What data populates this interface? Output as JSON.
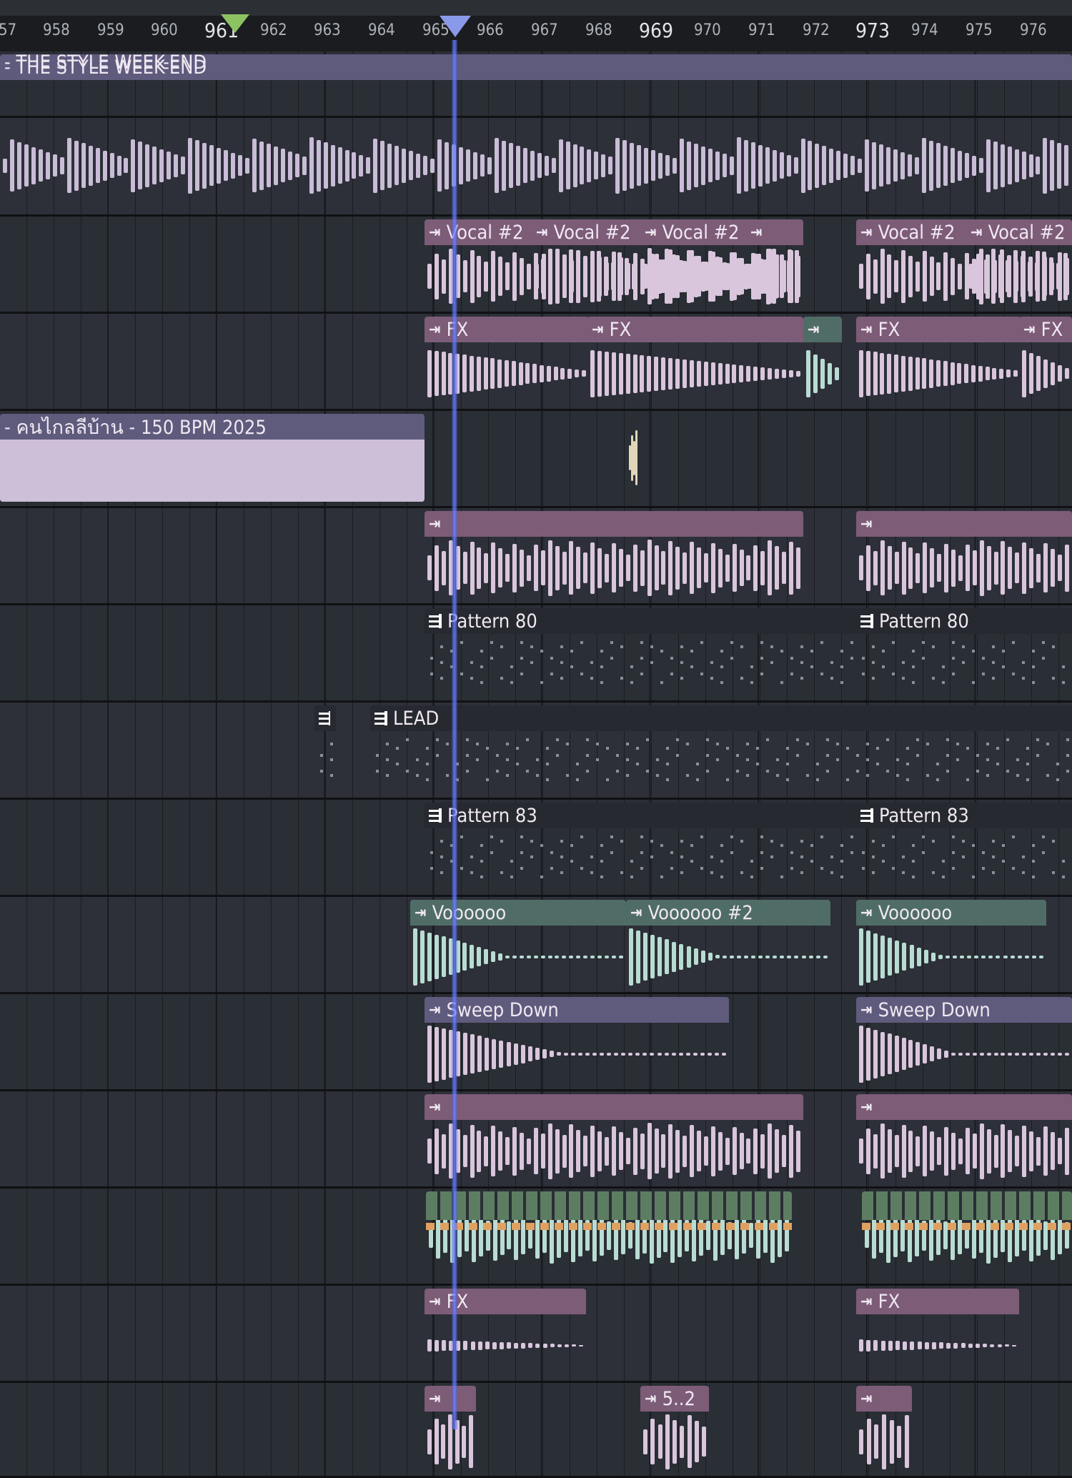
{
  "ruler": {
    "bars": [
      "57",
      "958",
      "959",
      "960",
      "961",
      "962",
      "963",
      "964",
      "965",
      "966",
      "967",
      "968",
      "969",
      "970",
      "971",
      "972",
      "973",
      "974",
      "975",
      "976"
    ],
    "major": [
      "961",
      "969",
      "973"
    ]
  },
  "markers": {
    "start_icon": "green-triangle-marker",
    "playhead_icon": "blue-triangle-marker"
  },
  "colors": {
    "clip_pink": "#7d5c78",
    "clip_lavender": "#5f5b7d",
    "clip_teal": "#4f6d66",
    "clip_olive": "#7a7458",
    "pattern_dark": "#26292f",
    "playhead": "#6e82ff"
  },
  "tracks": [
    {
      "clips": [
        {
          "label": "- THE STYLE WEEK-END"
        }
      ]
    },
    {
      "clips": [
        {
          "label": ""
        }
      ]
    },
    {
      "clips": [
        {
          "label": "Vocal #2"
        },
        {
          "label": "Vocal #2"
        },
        {
          "label": "Vocal #2"
        },
        {
          "label": ""
        },
        {
          "label": "Vocal #2"
        },
        {
          "label": "Vocal #2"
        }
      ]
    },
    {
      "clips": [
        {
          "label": "FX"
        },
        {
          "label": "FX"
        },
        {
          "label": ""
        },
        {
          "label": "FX"
        },
        {
          "label": "FX"
        }
      ]
    },
    {
      "clips": [
        {
          "label": "- คนไกลลีบ้าน - 150 BPM 2025"
        },
        {
          "label": ""
        }
      ]
    },
    {
      "clips": [
        {
          "label": ""
        },
        {
          "label": ""
        }
      ]
    },
    {
      "clips": [
        {
          "label": "Pattern 80"
        },
        {
          "label": "Pattern 80"
        }
      ]
    },
    {
      "clips": [
        {
          "label": ""
        },
        {
          "label": "LEAD"
        }
      ]
    },
    {
      "clips": [
        {
          "label": "Pattern 83"
        },
        {
          "label": "Pattern 83"
        }
      ]
    },
    {
      "clips": [
        {
          "label": "Voooooo"
        },
        {
          "label": "Voooooo #2"
        },
        {
          "label": "Voooooo"
        }
      ]
    },
    {
      "clips": [
        {
          "label": "Sweep Down"
        },
        {
          "label": "Sweep Down"
        }
      ]
    },
    {
      "clips": [
        {
          "label": ""
        },
        {
          "label": ""
        }
      ]
    },
    {
      "clips": [
        {
          "label": ""
        },
        {
          "label": ""
        }
      ]
    },
    {
      "clips": [
        {
          "label": "FX"
        },
        {
          "label": "FX"
        }
      ]
    },
    {
      "clips": [
        {
          "label": ""
        },
        {
          "label": "5..2"
        },
        {
          "label": ""
        }
      ]
    }
  ]
}
